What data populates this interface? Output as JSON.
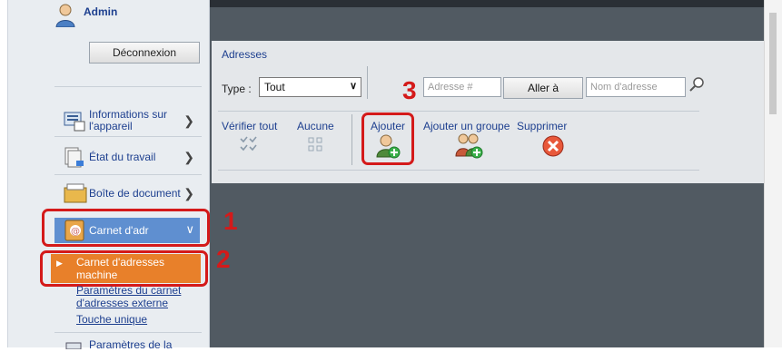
{
  "user": {
    "name": "Admin",
    "logout_label": "Déconnexion"
  },
  "sidebar": {
    "items": [
      {
        "label_line1": "Informations sur",
        "label_line2": "l'appareil"
      },
      {
        "label": "État du travail"
      },
      {
        "label": "Boîte de document"
      },
      {
        "label": "Carnet d'adr"
      }
    ],
    "subitems": [
      {
        "label_line1": "Carnet d'adresses",
        "label_line2": "machine"
      },
      {
        "label_line1": "Paramètres du carnet",
        "label_line2": "d'adresses externe"
      },
      {
        "label": "Touche unique"
      }
    ],
    "partial_item": "Paramètres de la"
  },
  "panel": {
    "title": "Adresses",
    "type_label": "Type :",
    "type_value": "Tout",
    "address_placeholder": "Adresse #",
    "goto_label": "Aller à",
    "name_placeholder": "Nom d'adresse",
    "actions": {
      "check_all": "Vérifier tout",
      "none": "Aucune",
      "add": "Ajouter",
      "add_group": "Ajouter un groupe",
      "delete": "Supprimer"
    }
  },
  "callouts": [
    "1",
    "2",
    "3"
  ],
  "colors": {
    "highlight": "#d41a1a",
    "active_item": "#5f8fd0",
    "active_subitem": "#e8802a"
  }
}
